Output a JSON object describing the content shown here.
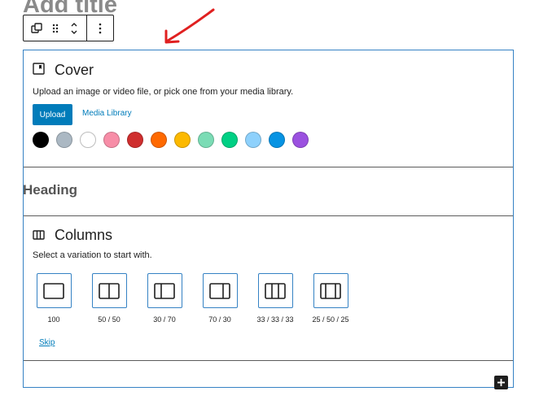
{
  "page": {
    "title": "Add title"
  },
  "toolbar": {
    "icons": [
      "block-transform-icon",
      "drag-handle-icon",
      "move-up-down-icon",
      "more-options-icon"
    ]
  },
  "cover": {
    "title": "Cover",
    "instructions": "Upload an image or video file, or pick one from your media library.",
    "upload_label": "Upload",
    "media_library_label": "Media Library",
    "swatches": [
      "#000000",
      "#abb8c3",
      "#ffffff",
      "#f78da7",
      "#cf2e2e",
      "#ff6900",
      "#fcb900",
      "#7bdcb5",
      "#00d084",
      "#8ed1fc",
      "#0693e3",
      "#9b51e0"
    ]
  },
  "heading": {
    "text": "Heading"
  },
  "columns": {
    "title": "Columns",
    "instructions": "Select a variation to start with.",
    "variations": [
      "100",
      "50 / 50",
      "30 / 70",
      "70 / 30",
      "33 / 33 / 33",
      "25 / 50 / 25"
    ],
    "skip_label": "Skip"
  },
  "colors": {
    "accent": "#007cba",
    "arrow": "#e02020"
  }
}
